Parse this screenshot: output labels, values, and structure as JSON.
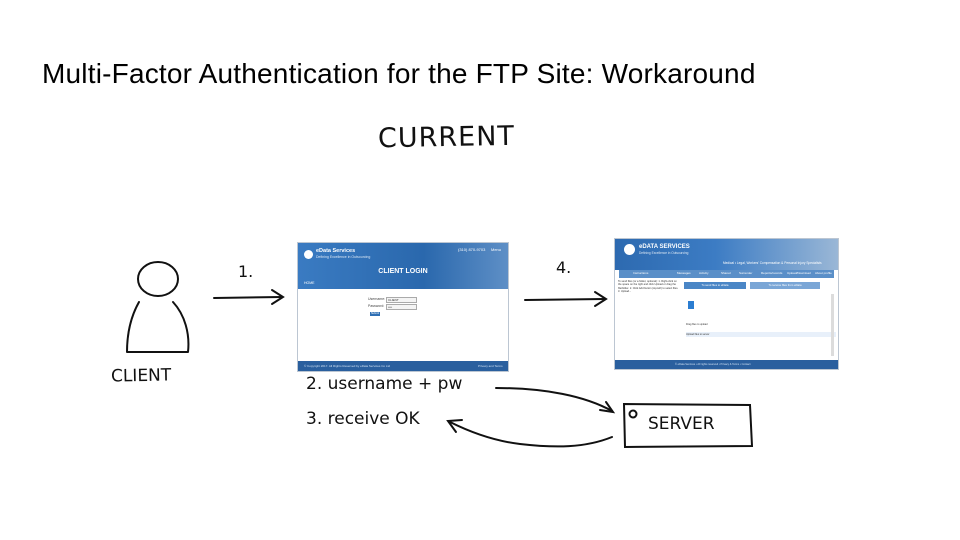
{
  "slide": {
    "title": "Multi-Factor Authentication for the FTP Site: Workaround",
    "subtitle": "CURRENT"
  },
  "diagram": {
    "client_label": "CLIENT",
    "server_label": "SERVER",
    "steps": {
      "step1": "1.",
      "step2": "2. username + pw",
      "step3": "3. receive OK",
      "step4": "4."
    }
  },
  "login_screenshot": {
    "brand": "eData Services",
    "tagline": "Defining Excellence in Outsourcing",
    "phone": "(310) 870-9703",
    "menu": "Menu",
    "home": "HOME",
    "heading": "CLIENT LOGIN",
    "username_label": "Username:",
    "username_value": "CLIENT",
    "password_label": "Password:",
    "password_value": "••••",
    "submit": "Submit",
    "copyright": "© Copyright 2017. All Rights Reserved by eData Services Co Ltd",
    "footer_right": "Privacy and Terms"
  },
  "ftp_screenshot": {
    "brand": "eDATA SERVICES",
    "tagline": "Defining Excellence in Outsourcing",
    "slogan": "Medical • Legal, Workers' Compensation & Personal Injury Specialists",
    "nav": [
      "Instructions",
      "Messages",
      "Activity",
      "Shared",
      "Surrender",
      "Reports/records",
      "Upload/Download",
      "About profile"
    ],
    "sidebar_text": "To send files (or a folder, optional): 1. Right-click on the space on the right and click Upload or drag the file/folder. 2. Click Add button (top-left) to select files. 3. Upload...",
    "tabs": [
      "To send files to eData",
      "To receive files from eData"
    ],
    "row1": "Drag files to upload",
    "row2": "Upload files to server",
    "copyright": "© eData Services • All rights reserved • Privacy & Terms • Contact"
  }
}
